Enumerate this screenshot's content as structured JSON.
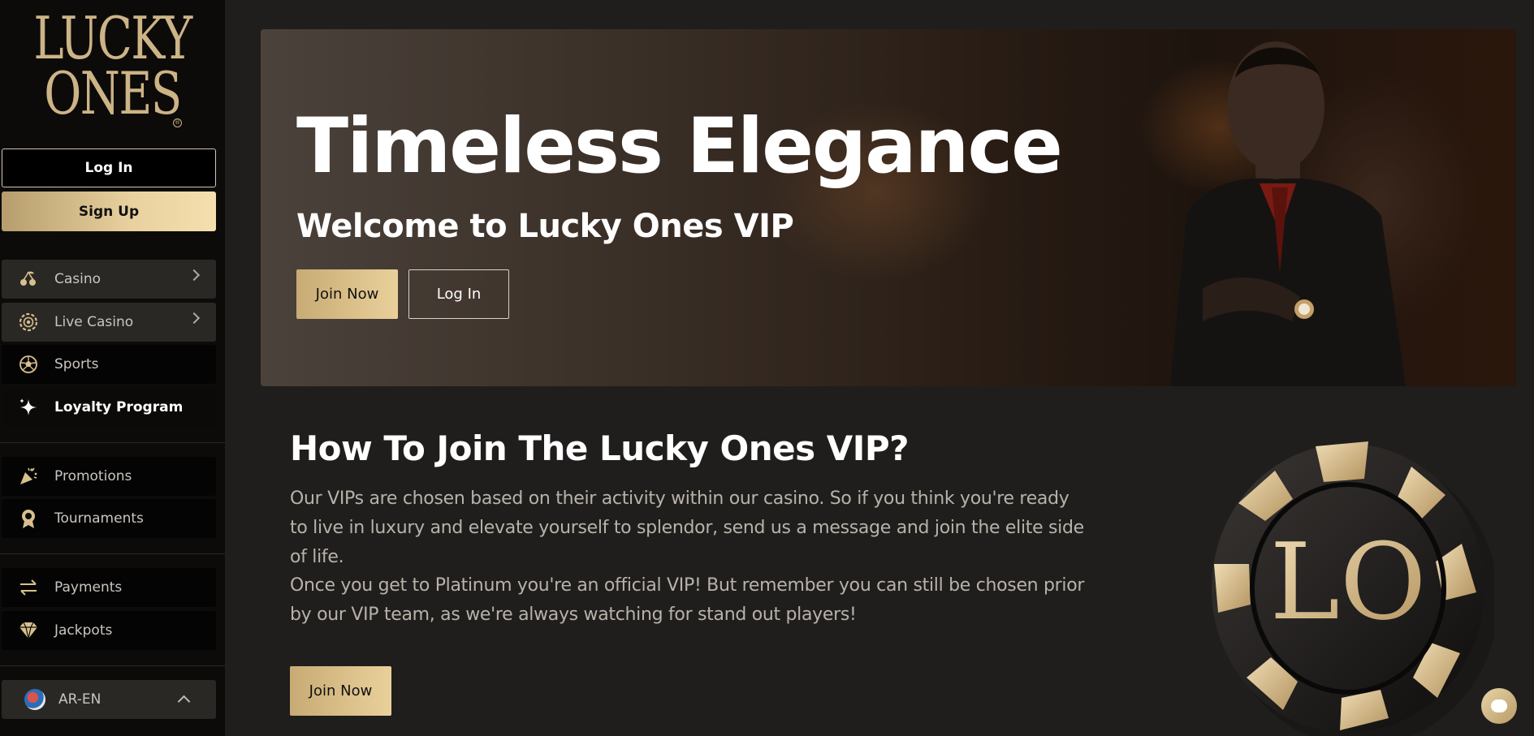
{
  "brand": {
    "logo_line1": "LUCKY",
    "logo_line2": "ONES",
    "registered": "®"
  },
  "sidebar": {
    "login_label": "Log In",
    "signup_label": "Sign Up",
    "items": [
      {
        "label": "Casino",
        "icon": "cherries-icon"
      },
      {
        "label": "Live Casino",
        "icon": "chip-icon"
      },
      {
        "label": "Sports",
        "icon": "soccer-ball-icon"
      },
      {
        "label": "Loyalty Program",
        "icon": "sparkle-icon"
      },
      {
        "label": "Promotions",
        "icon": "party-popper-icon"
      },
      {
        "label": "Tournaments",
        "icon": "trophy-icon"
      },
      {
        "label": "Payments",
        "icon": "arrows-exchange-icon"
      },
      {
        "label": "Jackpots",
        "icon": "diamond-icon"
      }
    ],
    "language": "AR-EN"
  },
  "hero": {
    "title": "Timeless Elegance",
    "subtitle": "Welcome to Lucky Ones VIP",
    "join_label": "Join Now",
    "login_label": "Log In"
  },
  "vip_section": {
    "title": "How To Join The Lucky Ones VIP?",
    "paragraph1": "Our VIPs are chosen based on their activity within our casino. So if you think you're ready to live in luxury and elevate yourself to splendor, send us a message and join the elite side of life.",
    "paragraph2": "Once you get to Platinum you're an official VIP! But remember you can still be chosen prior by our VIP team, as we're always watching for stand out players!",
    "join_label": "Join Now",
    "chip_monogram": "LO"
  },
  "colors": {
    "gold": "#d8c08e",
    "background": "#201e1c",
    "sidebar": "#0d0b0a"
  }
}
